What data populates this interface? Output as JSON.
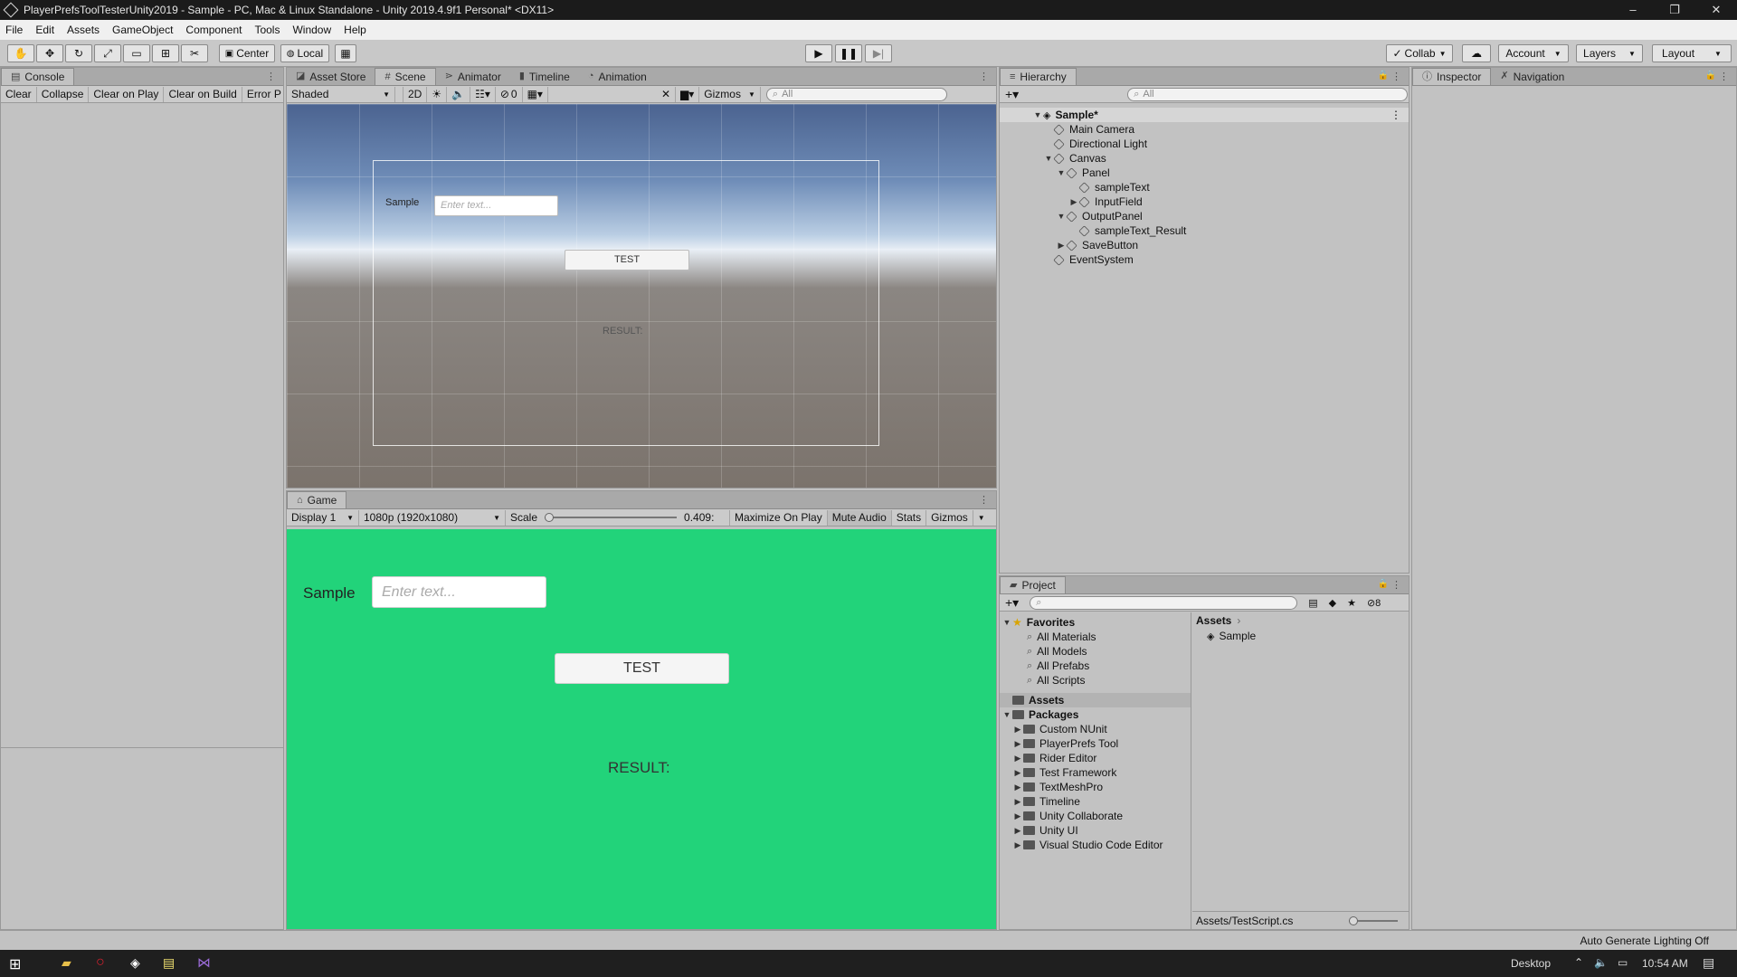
{
  "window": {
    "title": "PlayerPrefsToolTesterUnity2019 - Sample - PC, Mac & Linux Standalone - Unity 2019.4.9f1 Personal* <DX11>"
  },
  "menu": [
    "File",
    "Edit",
    "Assets",
    "GameObject",
    "Component",
    "Tools",
    "Window",
    "Help"
  ],
  "toolbar": {
    "center_label": "Center",
    "local_label": "Local",
    "collab_label": "Collab",
    "account_label": "Account",
    "layers_label": "Layers",
    "layout_label": "Layout"
  },
  "console": {
    "tab": "Console",
    "clear": "Clear",
    "collapse": "Collapse",
    "clear_on_play": "Clear on Play",
    "clear_on_build": "Clear on Build",
    "error_pause": "Error P"
  },
  "scene": {
    "tabs": [
      "Asset Store",
      "Scene",
      "Animator",
      "Timeline",
      "Animation"
    ],
    "shading": "Shaded",
    "mode_2d": "2D",
    "hidden_count": "0",
    "gizmos": "Gizmos",
    "search_placeholder": "All",
    "sample_label": "Sample",
    "input_placeholder": "Enter text...",
    "button_label": "TEST",
    "result_label": "RESULT:"
  },
  "game": {
    "tab": "Game",
    "display": "Display 1",
    "resolution": "1080p (1920x1080)",
    "scale_label": "Scale",
    "scale_value": "0.409",
    "maximize": "Maximize On Play",
    "mute": "Mute Audio",
    "stats": "Stats",
    "gizmos": "Gizmos",
    "sample_label": "Sample",
    "input_placeholder": "Enter text...",
    "button_label": "TEST",
    "result_label": "RESULT:",
    "bg_color": "#22d37a"
  },
  "hierarchy": {
    "tab": "Hierarchy",
    "search_placeholder": "All",
    "scene_name": "Sample*",
    "items": [
      "Main Camera",
      "Directional Light",
      "Canvas",
      "Panel",
      "sampleText",
      "InputField",
      "OutputPanel",
      "sampleText_Result",
      "SaveButton",
      "EventSystem"
    ]
  },
  "inspector": {
    "tab": "Inspector",
    "nav_tab": "Navigation"
  },
  "project": {
    "tab": "Project",
    "hidden_count": "8",
    "favorites_label": "Favorites",
    "favorites": [
      "All Materials",
      "All Models",
      "All Prefabs",
      "All Scripts"
    ],
    "assets_label": "Assets",
    "packages_label": "Packages",
    "packages": [
      "Custom NUnit",
      "PlayerPrefs Tool",
      "Rider Editor",
      "Test Framework",
      "TextMeshPro",
      "Timeline",
      "Unity Collaborate",
      "Unity UI",
      "Visual Studio Code Editor"
    ],
    "breadcrumb": "Assets",
    "asset_item": "Sample",
    "footer_path": "Assets/TestScript.cs"
  },
  "status": {
    "text": "Auto Generate Lighting Off"
  },
  "taskbar": {
    "desktop": "Desktop",
    "time": "10:54 AM"
  }
}
